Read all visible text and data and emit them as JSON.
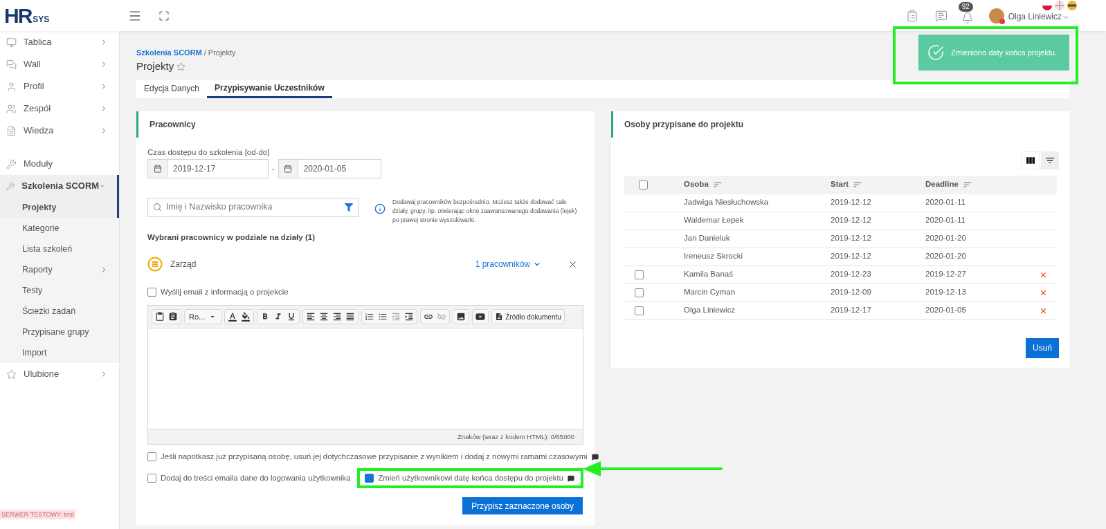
{
  "header": {
    "logo_mark": "HR",
    "logo_suffix": "SYS",
    "notification_count": "92",
    "user_name": "Olga Liniewicz"
  },
  "sidebar": {
    "groups": [
      [
        {
          "label": "Tablica",
          "active": false,
          "expanded": false
        },
        {
          "label": "Wall",
          "active": false,
          "expanded": false
        },
        {
          "label": "Profil",
          "active": false,
          "expanded": false
        },
        {
          "label": "Zespół",
          "active": false,
          "expanded": false
        },
        {
          "label": "Wiedza",
          "active": false,
          "expanded": false
        }
      ],
      [
        {
          "label": "Moduły",
          "active": false
        },
        {
          "label": "Szkolenia SCORM",
          "active": true,
          "expanded": true,
          "children": [
            {
              "label": "Projekty",
              "selected": true
            },
            {
              "label": "Kategorie",
              "selected": false
            },
            {
              "label": "Lista szkoleń",
              "selected": false
            },
            {
              "label": "Raporty",
              "selected": false,
              "expanded": false
            },
            {
              "label": "Testy",
              "selected": false
            },
            {
              "label": "Ścieżki zadań",
              "selected": false
            },
            {
              "label": "Przypisane grupy",
              "selected": false
            },
            {
              "label": "Import",
              "selected": false
            }
          ]
        },
        {
          "label": "Ulubione",
          "active": false,
          "expanded": false
        }
      ]
    ],
    "server_badge": "SERWER TESTOWY: test"
  },
  "breadcrumb": {
    "link": "Szkolenia SCORM",
    "separator": "/",
    "current": "Projekty"
  },
  "page_title": "Projekty",
  "tabs": [
    {
      "label": "Edycja Danych",
      "selected": false
    },
    {
      "label": "Przypisywanie Uczestników",
      "selected": true
    }
  ],
  "toast": {
    "message": "Zmieniono daty końca projektu.",
    "highlighted": true
  },
  "employees_panel": {
    "title": "Pracownicy",
    "access_label": "Czas dostępu do szkolenia [od-do]",
    "date_from": "2019-12-17",
    "date_separator": "-",
    "date_to": "2020-01-05",
    "search": {
      "placeholder": "Imię i Nazwisko pracownika"
    },
    "info_text": "Dodawaj pracowników bezpośrednio. Możesz także dodawać całe działy, grupy, itp. otwierając okno zaawansowanego dodawania (lejek) po prawej stronie wyszukiwarki.",
    "selected_heading": "Wybrani pracownicy w podziale na działy (1)",
    "departments": [
      {
        "name": "Zarząd",
        "count": "1 pracowników",
        "expanded": false
      }
    ],
    "email_option": {
      "label": "Wyślij email z informacją o projekcie",
      "checked": false
    },
    "editor": {
      "font": "Ro...",
      "source_button": "Źródło dokumentu",
      "counter": "Znaków (wraz z kodem HTML): 0/65000"
    },
    "option_rows": [
      [
        {
          "label": "Jeśli napotkasz już przypisaną osobę, usuń jej dotychczasowe przypisanie z wynikiem i dodaj z nowymi ramami czasowymi",
          "checked": false,
          "has_note": true,
          "highlighted": false
        }
      ],
      [
        {
          "label": "Dodaj do treści emaila dane do logowania użytkownika",
          "checked": false,
          "has_note": false,
          "highlighted": false
        },
        {
          "label": "Zmień użytkownikowi datę końca dostępu do projektu",
          "checked": true,
          "has_note": true,
          "highlighted": true
        }
      ]
    ],
    "submit": "Przypisz zaznaczone osoby"
  },
  "assigned_panel": {
    "title": "Osoby przypisane do projektu",
    "header_checked": false,
    "columns": [
      "Osoba",
      "Start",
      "Deadline"
    ],
    "rows": [
      {
        "kind": "fixed",
        "person": "Jadwiga Niesłuchowska",
        "start": "2019-12-12",
        "deadline": "2020-01-11"
      },
      {
        "kind": "fixed",
        "person": "Waldemar Łepek",
        "start": "2019-12-12",
        "deadline": "2020-01-11"
      },
      {
        "kind": "fixed",
        "person": "Jan Danieluk",
        "start": "2019-12-12",
        "deadline": "2020-01-20"
      },
      {
        "kind": "fixed",
        "person": "Ireneusz Skrocki",
        "start": "2019-12-12",
        "deadline": "2020-01-20"
      },
      {
        "kind": "removable",
        "checked": false,
        "person": "Kamila Banaś",
        "start": "2019-12-23",
        "deadline": "2019-12-27"
      },
      {
        "kind": "removable",
        "checked": false,
        "person": "Marcin Cyman",
        "start": "2019-12-09",
        "deadline": "2019-12-13"
      },
      {
        "kind": "removable",
        "checked": false,
        "person": "Olga Liniewicz",
        "start": "2019-12-17",
        "deadline": "2020-01-05"
      }
    ],
    "delete_button": "Usuń"
  }
}
